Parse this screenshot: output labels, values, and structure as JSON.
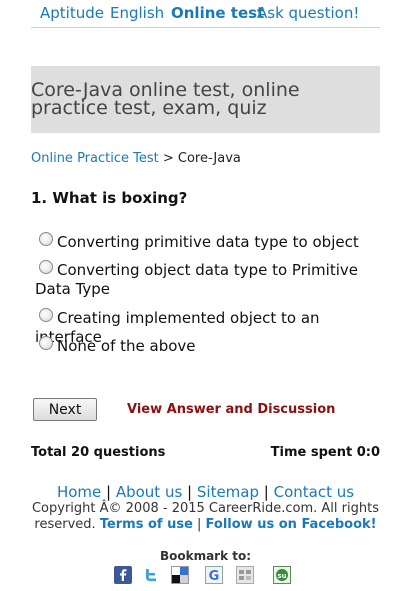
{
  "nav": {
    "aptitude": "Aptitude",
    "english": "English",
    "online_test": "Online test",
    "ask": "Ask question!"
  },
  "page_title": "Core-Java online test, online practice test, exam, quiz",
  "breadcrumb": {
    "link": "Online Practice Test",
    "separator": " > ",
    "current": "Core-Java"
  },
  "question": "1. What is boxing?",
  "options": [
    "Converting primitive data type to object",
    "Converting object data type to Primitive Data Type",
    "Creating implemented object to an interface",
    "None of the above"
  ],
  "buttons": {
    "next": "Next",
    "view_answer": "View Answer and Discussion"
  },
  "stats": {
    "total": "Total 20 questions",
    "time": "Time spent 0:0"
  },
  "footer": {
    "home": "Home",
    "about": "About us",
    "sitemap": "Sitemap",
    "contact": "Contact us",
    "sep": " | ",
    "copyright": "Copyright Â© 2008 - 2015 CareerRide.com. All rights reserved.",
    "terms": "Terms of use",
    "facebook": "Follow us on Facebook!",
    "bookmark": "Bookmark to:"
  },
  "icons": [
    "facebook-icon",
    "twitter-icon",
    "delicious-icon",
    "google-icon",
    "digg-icon",
    "stumbleupon-icon"
  ],
  "colors": {
    "link": "#1a7ab8",
    "answer": "#8b1111",
    "title_bg": "#dedede"
  }
}
